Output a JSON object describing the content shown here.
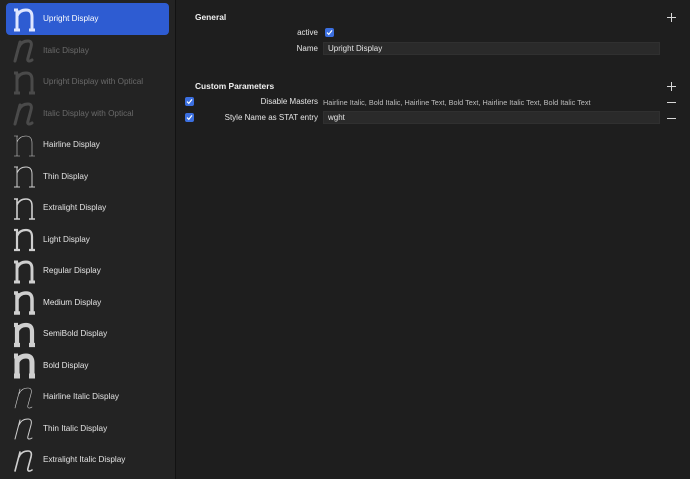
{
  "sidebar": {
    "instances": [
      {
        "label": "Upright Display",
        "glyph": "n-glyph-icon",
        "weight": 3,
        "italic": false,
        "selected": true,
        "dim": false
      },
      {
        "label": "Italic Display",
        "glyph": "n-italic-glyph-icon",
        "weight": 3,
        "italic": true,
        "selected": false,
        "dim": true
      },
      {
        "label": "Upright Display with Optical",
        "glyph": "n-glyph-icon",
        "weight": 3,
        "italic": false,
        "selected": false,
        "dim": true
      },
      {
        "label": "Italic Display with Optical",
        "glyph": "n-italic-glyph-icon",
        "weight": 3,
        "italic": true,
        "selected": false,
        "dim": true
      },
      {
        "label": "Hairline Display",
        "glyph": "n-glyph-icon",
        "weight": 0.6,
        "italic": false,
        "selected": false,
        "dim": false
      },
      {
        "label": "Thin Display",
        "glyph": "n-glyph-icon",
        "weight": 1,
        "italic": false,
        "selected": false,
        "dim": false
      },
      {
        "label": "Extralight Display",
        "glyph": "n-glyph-icon",
        "weight": 1.6,
        "italic": false,
        "selected": false,
        "dim": false
      },
      {
        "label": "Light Display",
        "glyph": "n-glyph-icon",
        "weight": 2.2,
        "italic": false,
        "selected": false,
        "dim": false
      },
      {
        "label": "Regular Display",
        "glyph": "n-glyph-icon",
        "weight": 2.9,
        "italic": false,
        "selected": false,
        "dim": false
      },
      {
        "label": "Medium Display",
        "glyph": "n-glyph-icon",
        "weight": 3.5,
        "italic": false,
        "selected": false,
        "dim": false
      },
      {
        "label": "SemiBold Display",
        "glyph": "n-glyph-icon",
        "weight": 4.2,
        "italic": false,
        "selected": false,
        "dim": false
      },
      {
        "label": "Bold Display",
        "glyph": "n-glyph-icon",
        "weight": 5,
        "italic": false,
        "selected": false,
        "dim": false
      },
      {
        "label": "Hairline Italic Display",
        "glyph": "n-italic-glyph-icon",
        "weight": 0.6,
        "italic": true,
        "selected": false,
        "dim": false
      },
      {
        "label": "Thin Italic Display",
        "glyph": "n-italic-glyph-icon",
        "weight": 1,
        "italic": true,
        "selected": false,
        "dim": false
      },
      {
        "label": "Extralight Italic Display",
        "glyph": "n-italic-glyph-icon",
        "weight": 1.6,
        "italic": true,
        "selected": false,
        "dim": false
      }
    ]
  },
  "general": {
    "title": "General",
    "active_label": "active",
    "active_checked": true,
    "name_label": "Name",
    "name_value": "Upright Display"
  },
  "custom_parameters": {
    "title": "Custom Parameters",
    "rows": [
      {
        "enabled": true,
        "name": "Disable Masters",
        "value": "Hairline Italic, Bold Italic, Hairline Text, Bold Text, Hairline Italic Text, Bold Italic Text"
      },
      {
        "enabled": true,
        "name": "Style Name as STAT entry",
        "value": "wght"
      }
    ]
  },
  "colors": {
    "selection": "#2e5cd2",
    "checkbox": "#3b6fe0",
    "background": "#1e1e1e",
    "sidebar": "#232323"
  }
}
